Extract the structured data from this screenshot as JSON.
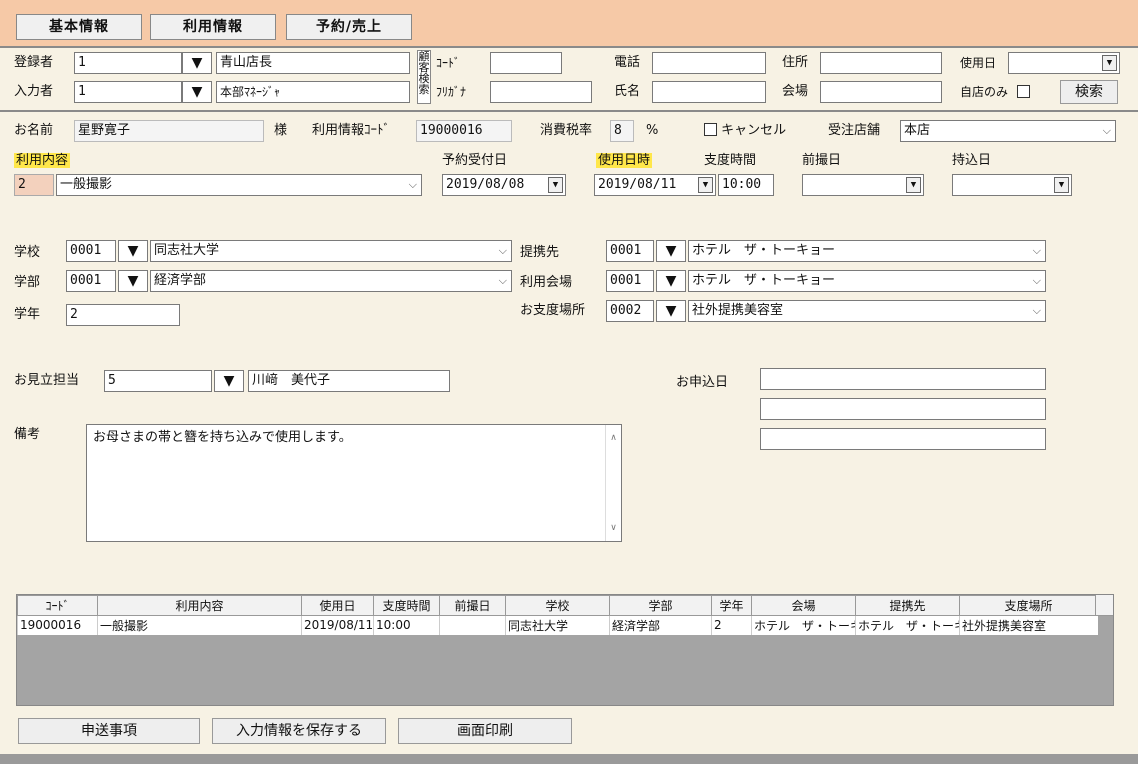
{
  "tabs": [
    {
      "label": "基本情報"
    },
    {
      "label": "利用情報"
    },
    {
      "label": "予約/売上"
    }
  ],
  "header": {
    "registrant_label": "登録者",
    "registrant_code": "1",
    "registrant_name": "青山店長",
    "inputter_label": "入力者",
    "inputter_code": "1",
    "inputter_name": "本部ﾏﾈｰｼﾞｬ",
    "customer_search_label": "顧客検索",
    "code_label": "ｺｰﾄﾞ",
    "code_value": "",
    "furigana_label": "ﾌﾘｶﾞﾅ",
    "furigana_value": "",
    "phone_label": "電話",
    "phone_value": "",
    "name_label": "氏名",
    "name_value": "",
    "address_label": "住所",
    "address_value": "",
    "venue_label": "会場",
    "venue_value": "",
    "useday_label": "使用日",
    "useday_value": "",
    "own_store_label": "自店のみ",
    "search_button": "検索"
  },
  "info": {
    "name_label": "お名前",
    "name_value": "星野寛子",
    "honorific": "様",
    "usage_code_label": "利用情報ｺｰﾄﾞ",
    "usage_code_value": "19000016",
    "tax_label": "消費税率",
    "tax_value": "8",
    "tax_unit": "%",
    "cancel_label": "キャンセル",
    "store_label": "受注店舗",
    "store_value": "本店"
  },
  "usage": {
    "content_label": "利用内容",
    "content_code": "2",
    "content_value": "一般撮影",
    "reserve_date_label": "予約受付日",
    "reserve_date_value": "2019/08/08",
    "use_datetime_label": "使用日時",
    "use_date_value": "2019/08/11",
    "prep_time_label": "支度時間",
    "prep_time_value": "10:00",
    "pre_shoot_label": "前撮日",
    "pre_shoot_value": "",
    "bring_day_label": "持込日",
    "bring_day_value": ""
  },
  "school": {
    "school_label": "学校",
    "school_code": "0001",
    "school_value": "同志社大学",
    "faculty_label": "学部",
    "faculty_code": "0001",
    "faculty_value": "経済学部",
    "grade_label": "学年",
    "grade_value": "2",
    "partner_label": "提携先",
    "partner_code": "0001",
    "partner_value": "ホテル　ザ・トーキョー",
    "venue_label": "利用会場",
    "venue_code": "0001",
    "venue_value": "ホテル　ザ・トーキョー",
    "prep_place_label": "お支度場所",
    "prep_place_code": "0002",
    "prep_place_value": "社外提携美容室"
  },
  "staff": {
    "label": "お見立担当",
    "code": "5",
    "name": "川﨑　美代子",
    "apply_date_label": "お申込日",
    "apply_date_1": "",
    "apply_date_2": "",
    "apply_date_3": ""
  },
  "remarks": {
    "label": "備考",
    "value": "お母さまの帯と簪を持ち込みで使用します。"
  },
  "table": {
    "headers": [
      "ｺｰﾄﾞ",
      "利用内容",
      "使用日",
      "支度時間",
      "前撮日",
      "学校",
      "学部",
      "学年",
      "会場",
      "提携先",
      "支度場所"
    ],
    "rows": [
      [
        "19000016",
        "一般撮影",
        "2019/08/11",
        "10:00",
        "",
        "同志社大学",
        "経済学部",
        "2",
        "ホテル　ザ・トーキョー",
        "ホテル　ザ・トーキョー",
        "社外提携美容室"
      ]
    ]
  },
  "buttons": {
    "notes": "申送事項",
    "save": "入力情報を保存する",
    "print": "画面印刷"
  },
  "colors": {
    "background": "#f7f2e4",
    "topbar": "#f6c9a7",
    "highlight": "#ffe74a",
    "grid_empty": "#a4a4a4"
  }
}
